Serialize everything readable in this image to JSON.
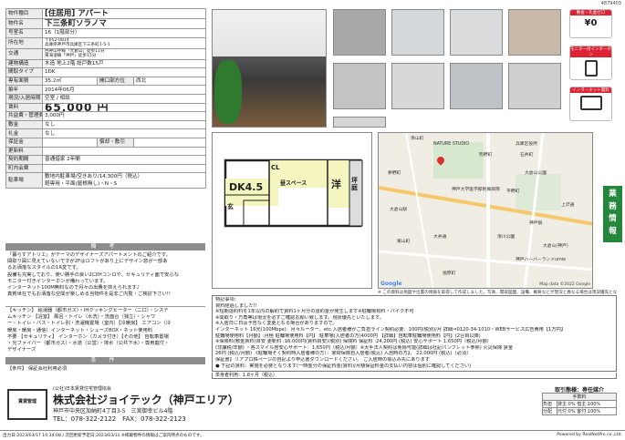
{
  "id": "4879403",
  "rows": [
    {
      "k": "物件種目",
      "v": "[住居用] アパート",
      "cls": "bg"
    },
    {
      "k": "物件名",
      "v": "下三条町ソラノマ",
      "cls": "bg"
    },
    {
      "k": "号室名",
      "v": "16（1階部分）"
    },
    {
      "k": "所在地",
      "v": "〒652-0814",
      "v2": "兵庫県神戸市兵庫区下三条町1-5-1",
      "cls": "sm"
    },
    {
      "k": "交通",
      "v": "西神山手線「大倉山」徒歩11分",
      "v2": "東海道線「神戸」徒歩15分",
      "cls": "sm"
    },
    {
      "k": "建物構造",
      "v": "木造 地上2階 総戸数15戸"
    },
    {
      "k": "間取タイプ",
      "v": "1DK"
    },
    {
      "k": "専有面積",
      "v": "35.2㎡",
      "k2": "開口部方位",
      "v3": "西北"
    },
    {
      "k": "築年",
      "v": "2014年06月"
    },
    {
      "k": "現況/入居時期",
      "v": "空室 / 相談"
    },
    {
      "k": "賃料",
      "v": "65,000 円",
      "cls": "big"
    },
    {
      "k": "共益費・管理費",
      "v": "3,000円"
    },
    {
      "k": "敷金",
      "v": "なし"
    },
    {
      "k": "礼金",
      "v": "なし"
    },
    {
      "k": "保証金",
      "v": "",
      "k2": "償却・敷引",
      "v3": ""
    },
    {
      "k": "更新料",
      "v": ""
    },
    {
      "k": "契約期間",
      "v": "普通借家 2年間"
    },
    {
      "k": "町内会費",
      "v": ""
    },
    {
      "k": "駐車場",
      "v": "敷地内駐車場/空きあり/14,300円（税込）",
      "v2": "軽専用・平面(屋根無し)・N・S"
    }
  ],
  "bikou_title": "備 考",
  "bikou": [
    "「暮らすアトリエ」がテーマのデザイナーズアパートメントのご紹介です。",
    "間取り図に見えていないですが2Fはロフトがあり上にデザイン窓が一部あ",
    "るお洒落なスタイルの1R変です。",
    "設備も充実しており、使い勝手の良い2口IHコンロや、セキュリティ面で安心な",
    "モニター付きインターホンが備わっています。",
    "インターネット100M無料なので月々の出費を抑えられます♪",
    "真賀世在でもお洒落な空間が楽しめる当物件を是非ご内覧・ご検討下さい!!"
  ],
  "equip": [
    "【キッチン】 給湯器（都市ガス）・IHクッキングヒーター（二口）・システ",
    "ムキッチン 【浴室】 風呂・トイレ（水洗）・洗面台（独立）・シャワ",
    "ー・トイレ・バス・トイレ別・洗濯機置場（室内）【冷暖房】 エアコン（冷",
    "暖房・暖房・通信）インターネット・シューズBOX・ネット使用料",
    "不要 【セキュリティ】 インターホン（カメラ付き）【その他】 自転車置場",
    "・光ファイバー（都市ガス）・水道（公営）・排水（公共下水）・専用庭付・",
    "デザイナーズ"
  ],
  "conditions_title": "条 件",
  "conditions": "【条件】 保証会社利用必須",
  "remarks": [
    "特記事項：",
    "資料経過しました!!",
    "※短期違約料を1年以内の解約で賃料1ヶ月分の違約金が発生します※駐輪場有料・バイク不可",
    "※間取り・方角等は現況を必ずご確認お願い致します。現状優先といたします。",
    "※入居日に日は予告なく変更となる場合がありますので。",
    "インターネット 16光(100Mbps)：月々ルーター、etc.入居者様がご負担ライン契約必要：100円(税別)/月 詳細⇒0120-34-1010・WEBサービス広告費用【1万円】",
    "駐輪場使用料【月額】:月極 駐輪場使用料【円】:駐車場(入居者の方)4000円 【詳細】自転車駐輪場使用料【円】(2台目以降)",
    "※保険料(敷金賃料)目安 更新料 :16,000円(賃料目安)(税別) 保険料 保証料 :24,200円 (税込)  安心サポート 1,650円（税込/月額）",
    "(非課税/年額) ・各スマイル居安心サポート：1,650円（税込/月額）※大手法人契約は免除可能(詳細は社記パンフレット参照) 火災保険 賃金",
    "26円 (税込/月額) 《駐輪場そく契約時入居者様の方）：家財保険自入居者(税込) 入居時の方】、 22,000円 (税込)〔必須〕",
    "保証書】リアプロ株ページの自記より申込書ダウンロードください。 ご入居時の振込み先にあります",
    "● 下記の賃料：実施を必要となります(一時金分の保証料金(賃料)/月額保証料金の支払い内容は個別に確認してください)"
  ],
  "labels": {
    "transaction": "取引態様：専任媒介",
    "fee_title": "手数料",
    "fee_rows": [
      [
        "負担",
        "貸主:0% 借主:100%"
      ],
      [
        "分配",
        "元付:0% 客付:100%"
      ]
    ],
    "remark_note": "入居可能日：現況優先",
    "move": "単身者利用：1.8ヶ月（税込）",
    "map_note": "※ この資料は地図や位置の情報を取得して作成しました。写真、間取図面、設備、概要などが現況と異なる場合は現況優先となります。",
    "map_credit": "Map data ©2022 Google"
  },
  "company": {
    "org": "(公社)日本賃貸住宅管理協会",
    "name": "株式会社ジョイテック（神戸エリア）",
    "addr": "神戸市中央区加納町4丁目3-5　三宮御幸ビル4階",
    "tel": "TEL：078-322-2122　FAX：078-322-2123"
  },
  "footer": "出力日:2023/03/17 10:34:08 / 次回更新予定日:2023/03/31 ※掲載物件の情報はご案内時点のものです。",
  "powered": "Powered by RealNetPro co.,Ltd.",
  "floorplan": {
    "room": "DK4.5",
    "area": "昼スペース",
    "room2": "洋",
    "balcony": "坪庭",
    "cl": "CL",
    "genkan": "玄"
  },
  "badges": [
    "敷金・礼金ゼロ",
    "モニター付インターホン",
    "インターネット無料"
  ],
  "sidebar": "業務情報",
  "map_places": [
    "湊山町",
    "NATURE STUDIO",
    "兵庫区役所",
    "石井町",
    "熊野町",
    "大倉山公園",
    "神戸大学医学部附属病院",
    "夢野町",
    "平野町",
    "神戸駅",
    "大倉山駅",
    "大井通",
    "東山町",
    "上沢通",
    "湊川公園",
    "福原町",
    "神戸ハーバーランドumie",
    "大倉山(神戸)"
  ],
  "colors": {
    "accent": "#25873c",
    "pin": "#d9302c"
  }
}
